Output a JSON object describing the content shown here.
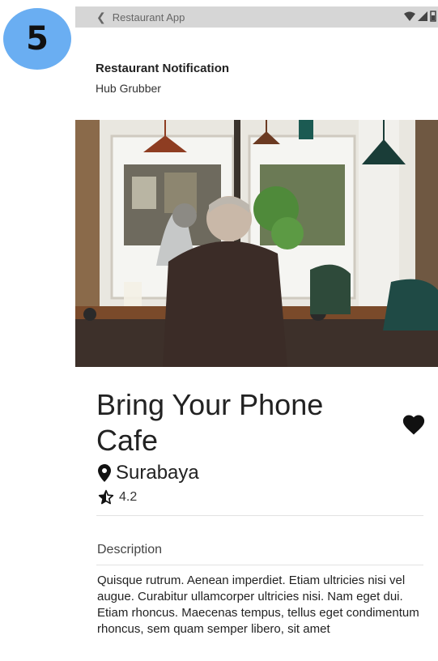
{
  "step_badge": "5",
  "status_bar": {
    "app_name": "Restaurant App"
  },
  "notification": {
    "title": "Restaurant Notification",
    "subtitle": "Hub Grubber"
  },
  "restaurant": {
    "name": "Bring Your Phone Cafe",
    "city": "Surabaya",
    "rating": "4.2",
    "favorite": true
  },
  "description": {
    "heading": "Description",
    "text": "Quisque rutrum. Aenean imperdiet. Etiam ultricies nisi vel augue. Curabitur ullamcorper ultricies nisi. Nam eget dui. Etiam rhoncus. Maecenas tempus, tellus eget condimentum rhoncus, sem quam semper libero, sit amet"
  },
  "icons": {
    "back": "back-arrow-icon",
    "wifi": "wifi-icon",
    "signal": "signal-icon",
    "battery": "battery-icon",
    "favorite": "heart-icon",
    "location": "location-pin-icon",
    "rating": "star-icon"
  },
  "colors": {
    "badge": "#6aaef2",
    "status_bar": "#d6d6d6",
    "text": "#222222"
  }
}
